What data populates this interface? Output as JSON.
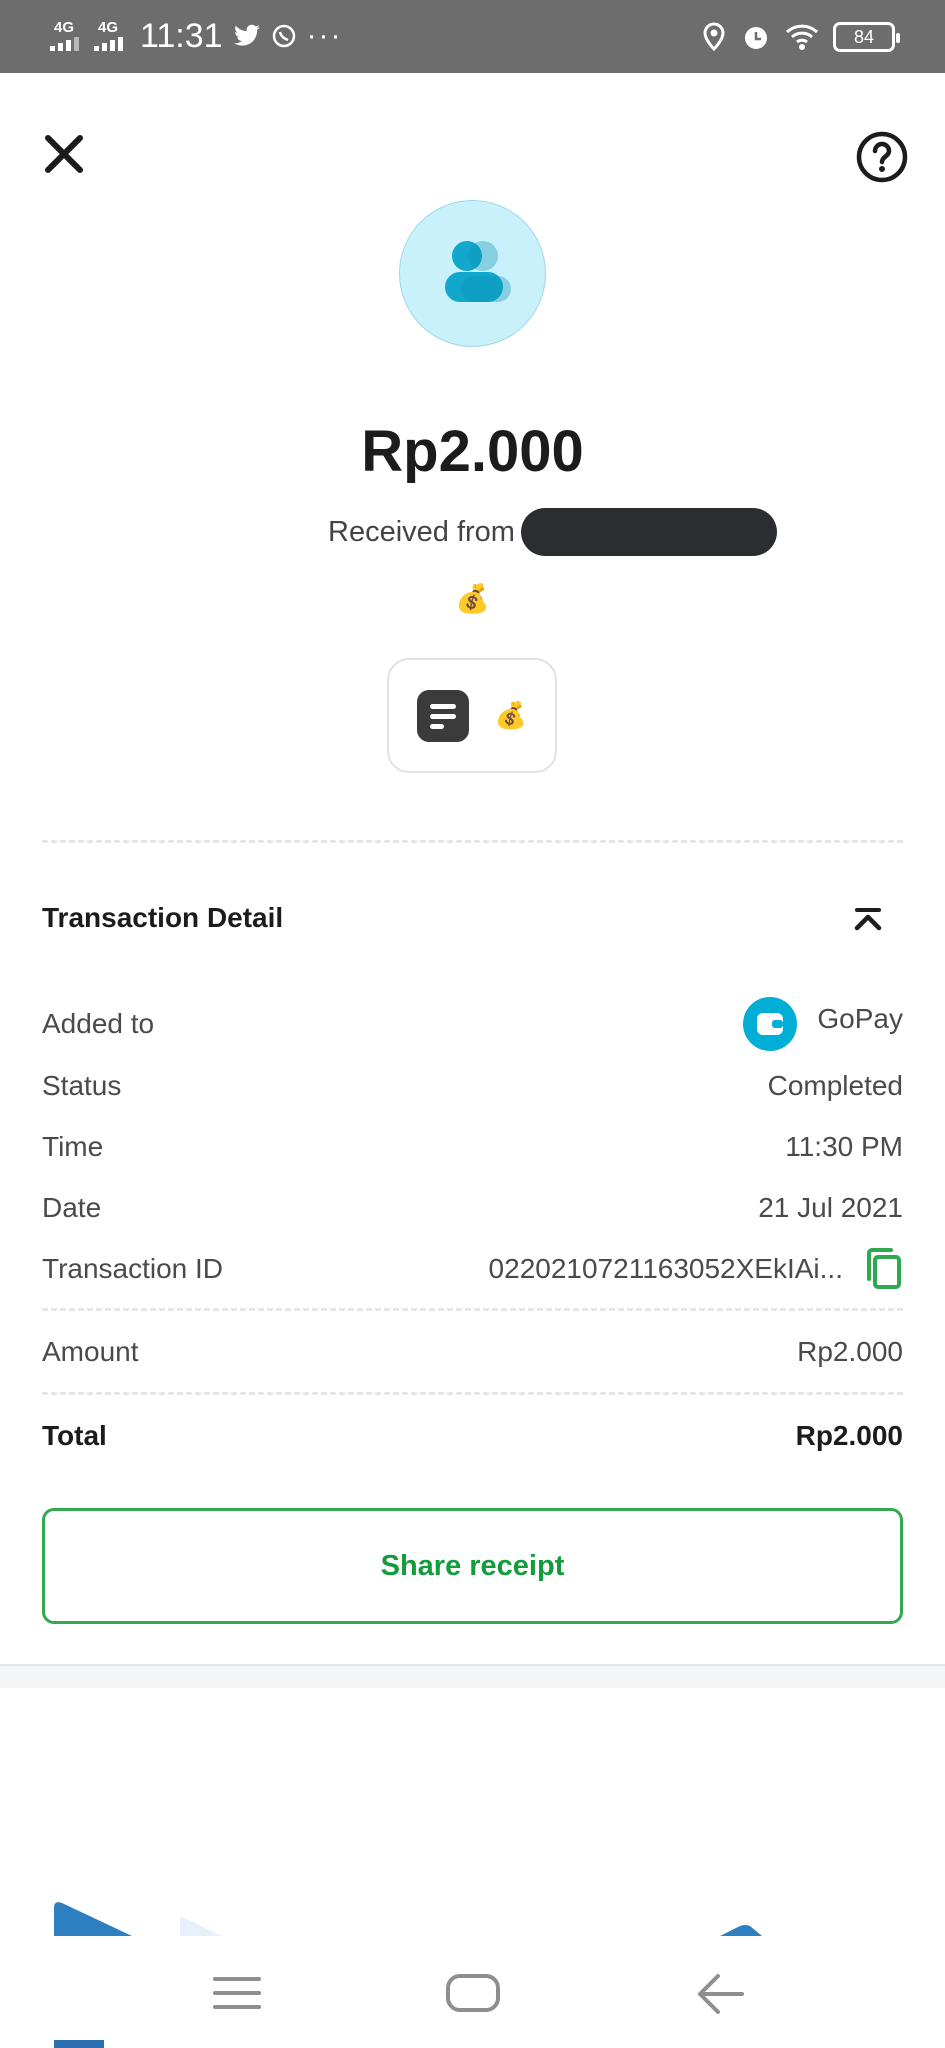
{
  "status_bar": {
    "network_1": "4G",
    "network_2": "4G",
    "time": "11:31",
    "battery": "84"
  },
  "icons": {
    "close": "close-icon",
    "help": "help-icon",
    "avatar": "people-icon",
    "note": "note-icon",
    "collapse": "chevron-up-icon",
    "wallet": "gopay-wallet-icon",
    "copy": "copy-icon"
  },
  "transaction": {
    "amount": "Rp2.000",
    "received_from_label": "Received from",
    "message_emoji": "💰",
    "note_emoji": "💰"
  },
  "detail": {
    "title": "Transaction Detail",
    "rows": [
      {
        "label": "Added to",
        "value": "GoPay"
      },
      {
        "label": "Status",
        "value": "Completed"
      },
      {
        "label": "Time",
        "value": "11:30 PM"
      },
      {
        "label": "Date",
        "value": "21 Jul 2021"
      },
      {
        "label": "Transaction ID",
        "value": "0220210721163052XEkIAi..."
      }
    ],
    "amount_label": "Amount",
    "amount_value": "Rp2.000",
    "total_label": "Total",
    "total_value": "Rp2.000"
  },
  "actions": {
    "share_label": "Share receipt"
  },
  "colors": {
    "accent_green": "#129c3c",
    "gopay_blue": "#00aed6",
    "avatar_bg": "#c8f1fb"
  }
}
